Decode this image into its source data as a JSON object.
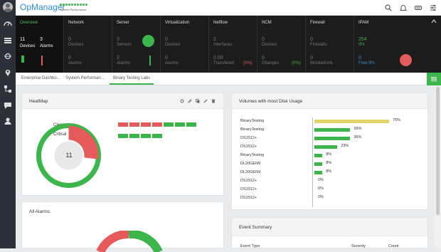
{
  "app": {
    "title": "OpManager",
    "subtitle": "System Performance"
  },
  "summary": {
    "columns": [
      {
        "title": "Overview",
        "primary": "11",
        "primary_label": "Devices",
        "secondary": "3",
        "secondary_label": "Alarms"
      },
      {
        "title": "Network",
        "primary": "0",
        "primary_label": "Devices",
        "secondary": "0",
        "secondary_label": "Alarms"
      },
      {
        "title": "Server",
        "primary": "3",
        "primary_label": "Servers",
        "secondary": "2",
        "secondary_label": "Alarms"
      },
      {
        "title": "Virtualization",
        "primary": "0",
        "primary_label": "Devices",
        "secondary": "0",
        "secondary_label": "Alarms"
      },
      {
        "title": "Netflow",
        "primary": "2",
        "primary_label": "Interfaces",
        "secondary": "0.00",
        "secondary_label": "Transfered",
        "badge": "(0%)"
      },
      {
        "title": "NCM",
        "primary": "0",
        "primary_label": "Devices",
        "secondary": "0",
        "secondary_label": "Changes",
        "badge": "(0%)"
      },
      {
        "title": "Firewall",
        "primary": "0",
        "primary_label": "Firewalls",
        "secondary": "0",
        "secondary_label": "BlockedUrls"
      },
      {
        "title": "IPAM",
        "primary": "254",
        "primary_label": "IPs",
        "secondary": "0",
        "secondary_label": "Free IPs"
      }
    ]
  },
  "tabs": [
    "Enterprise Dashbo...",
    "System Performan...",
    "Binary Testing Labs"
  ],
  "heatmap": {
    "title": "HeatMap",
    "legend_clear": "Clear",
    "legend_critical": "Critical",
    "center_value": "11",
    "critical_fraction": 0.27,
    "cells": [
      "#e55a5a",
      "#e55a5a",
      "#e55a5a",
      "#e55a5a",
      "#3cb54a",
      "#3cb54a",
      "#3cb54a",
      "#3cb54a",
      "#3cb54a",
      "#3cb54a",
      "#3cb54a"
    ]
  },
  "volumes": {
    "title": "Volumes with most Disk Usage",
    "rows": [
      {
        "name": "BinaryTesting",
        "pct": "75%",
        "value": 75,
        "color": "#e3d46a"
      },
      {
        "name": "BinaryTesting",
        "pct": "36%",
        "value": 36,
        "color": "#3cb54a"
      },
      {
        "name": "DS1512+",
        "pct": "36%",
        "value": 36,
        "color": "#3cb54a"
      },
      {
        "name": "DS1512+",
        "pct": "23%",
        "value": 23,
        "color": "#3cb54a"
      },
      {
        "name": "BinaryTesting",
        "pct": "8%",
        "value": 8,
        "color": "#3cb54a"
      },
      {
        "name": "DL20GEN9",
        "pct": "8%",
        "value": 8,
        "color": "#3cb54a"
      },
      {
        "name": "DL20GEN9",
        "pct": "8%",
        "value": 8,
        "color": "#3cb54a"
      },
      {
        "name": "DS1512+",
        "pct": "0%",
        "value": 0,
        "color": "#3cb54a"
      },
      {
        "name": "DS1512+",
        "pct": "0%",
        "value": 0,
        "color": "#3cb54a"
      },
      {
        "name": "DS1512+",
        "pct": "0%",
        "value": 0,
        "color": "#3cb54a"
      }
    ]
  },
  "alarms": {
    "title": "All Alarms"
  },
  "events": {
    "title": "Event Summary",
    "columns": [
      "Event Type",
      "Severity",
      "Count"
    ]
  },
  "colors": {
    "green": "#3cb54a",
    "red": "#e55a5a",
    "blue": "#2b8fd6"
  }
}
